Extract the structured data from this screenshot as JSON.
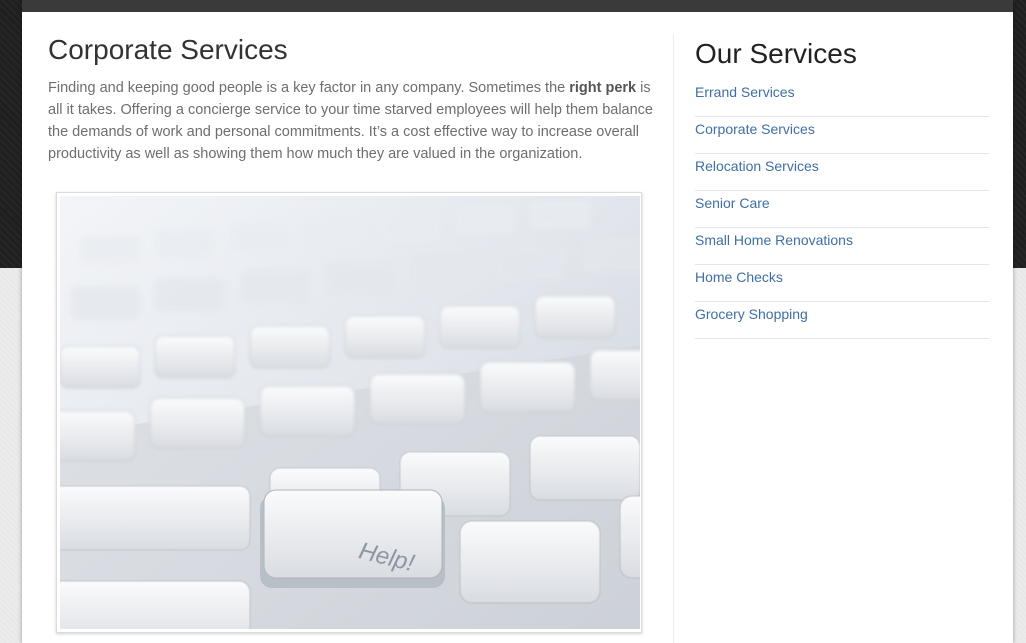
{
  "main": {
    "title": "Corporate Services",
    "intro_before": "Finding and keeping good people is a key factor in any company. Sometimes the ",
    "intro_bold": "right perk",
    "intro_after": " is all it takes. Offering a concierge service to your time starved employees will help them balance the demands of work and personal commitments. It’s a cost effective way to increase overall productivity as well as showing them how much they are valued in the organization.",
    "photo": {
      "subject": "keyboard-help-key",
      "key_label": "Help!"
    }
  },
  "sidebar": {
    "title": "Our Services",
    "items": [
      {
        "label": "Errand Services"
      },
      {
        "label": "Corporate Services"
      },
      {
        "label": "Relocation Services"
      },
      {
        "label": "Senior Care"
      },
      {
        "label": "Small Home Renovations"
      },
      {
        "label": "Home Checks"
      },
      {
        "label": "Grocery Shopping"
      }
    ]
  },
  "colors": {
    "link": "#3f6fa3",
    "body_text": "#6e6e6e",
    "heading": "#333333",
    "dark_background": "#1f1f1f",
    "panel": "#ffffff"
  }
}
